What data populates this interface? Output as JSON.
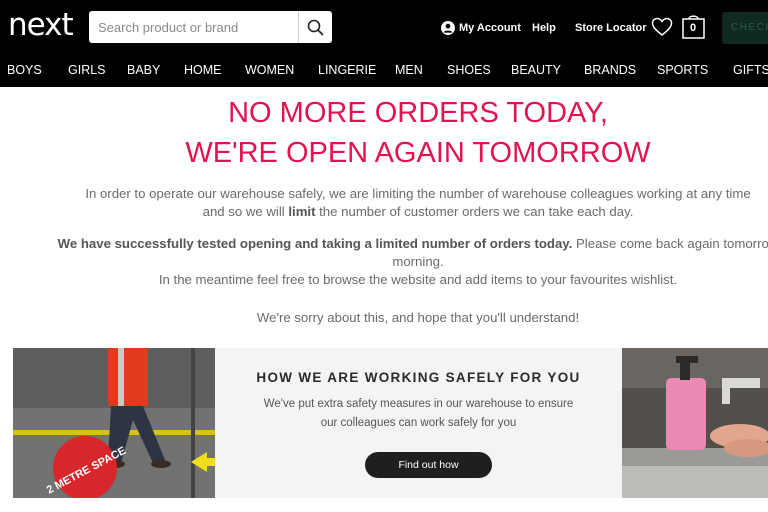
{
  "header": {
    "logo": "next",
    "search_placeholder": "Search product or brand",
    "my_account": "My Account",
    "help": "Help",
    "store_locator": "Store Locator",
    "bag_count": "0",
    "checkout": "CHECKOUT"
  },
  "nav": [
    "BOYS",
    "GIRLS",
    "BABY",
    "HOME",
    "WOMEN",
    "LINGERIE",
    "MEN",
    "SHOES",
    "BEAUTY",
    "BRANDS",
    "SPORTS",
    "GIFTS"
  ],
  "notice": {
    "headline_1": "NO MORE ORDERS TODAY,",
    "headline_2": "WE'RE OPEN AGAIN TOMORROW",
    "p1_line1": "In order to operate our warehouse safely, we are limiting the number of warehouse colleagues working at any time",
    "p1_line2_a": "and so we will ",
    "p1_line2_bold": "limit",
    "p1_line2_b": " the number of customer orders we can take each day.",
    "p2_bold": "We have successfully tested opening and taking a limited number of orders today.",
    "p2_rest": " Please come back again tomorrow",
    "p2_line2": "morning.",
    "p3": "In the meantime feel free to browse the website and add items to your favourites wishlist.",
    "p4": "We're sorry about this, and hope that you'll understand!"
  },
  "banner": {
    "title": "HOW WE ARE WORKING SAFELY FOR YOU",
    "text_line1": "We've put extra safety measures in our warehouse to ensure",
    "text_line2": "our colleagues can work safely for you",
    "button": "Find out how",
    "floor_sign": "2 METRE SPACE"
  },
  "colors": {
    "headline": "#e21350",
    "header_bg": "#000000",
    "checkout_bg": "#0f2a22"
  }
}
